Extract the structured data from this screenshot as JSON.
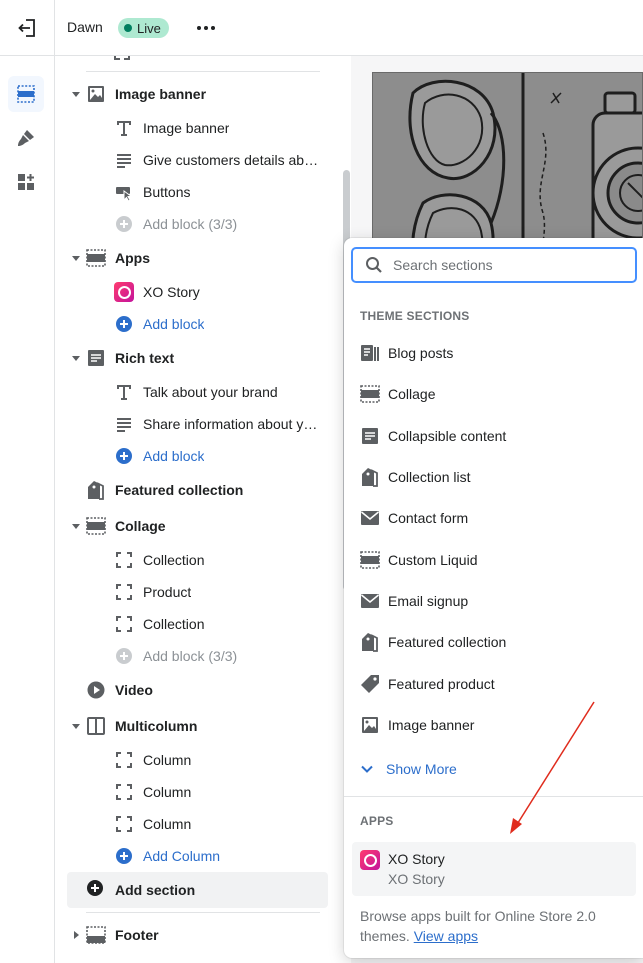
{
  "topbar": {
    "theme_name": "Dawn",
    "status_badge": "Live"
  },
  "tree": {
    "sections": [
      {
        "label": "Image banner",
        "expanded": true,
        "icon": "image-icon",
        "blocks": [
          {
            "label": "Image banner",
            "icon": "text-icon"
          },
          {
            "label": "Give customers details ab…",
            "icon": "paragraph-icon"
          },
          {
            "label": "Buttons",
            "icon": "button-icon"
          },
          {
            "label": "Add block (3/3)",
            "icon": "add-circle-icon",
            "muted": true
          }
        ]
      },
      {
        "label": "Apps",
        "expanded": true,
        "icon": "apps-section-icon",
        "blocks": [
          {
            "label": "XO Story",
            "icon": "xo-story-app-icon"
          },
          {
            "label": "Add block",
            "icon": "add-circle-icon",
            "add": true
          }
        ]
      },
      {
        "label": "Rich text",
        "expanded": true,
        "icon": "rich-text-icon",
        "blocks": [
          {
            "label": "Talk about your brand",
            "icon": "text-icon"
          },
          {
            "label": "Share information about y…",
            "icon": "paragraph-icon"
          },
          {
            "label": "Add block",
            "icon": "add-circle-icon",
            "add": true
          }
        ]
      },
      {
        "label": "Featured collection",
        "expanded": false,
        "icon": "collection-tags-icon",
        "blocks": []
      },
      {
        "label": "Collage",
        "expanded": true,
        "icon": "collage-icon",
        "blocks": [
          {
            "label": "Collection",
            "icon": "frame-icon"
          },
          {
            "label": "Product",
            "icon": "frame-icon"
          },
          {
            "label": "Collection",
            "icon": "frame-icon"
          },
          {
            "label": "Add block (3/3)",
            "icon": "add-circle-icon",
            "muted": true
          }
        ]
      },
      {
        "label": "Video",
        "expanded": false,
        "icon": "play-icon",
        "blocks": []
      },
      {
        "label": "Multicolumn",
        "expanded": true,
        "icon": "columns-icon",
        "blocks": [
          {
            "label": "Column",
            "icon": "frame-icon"
          },
          {
            "label": "Column",
            "icon": "frame-icon"
          },
          {
            "label": "Column",
            "icon": "frame-icon"
          },
          {
            "label": "Add Column",
            "icon": "add-circle-icon",
            "add": true
          }
        ]
      }
    ],
    "add_section_label": "Add section",
    "footer_label": "Footer"
  },
  "picker": {
    "search_placeholder": "Search sections",
    "theme_sections_header": "THEME SECTIONS",
    "theme_sections": [
      {
        "label": "Blog posts",
        "icon": "blog-icon"
      },
      {
        "label": "Collage",
        "icon": "collage-icon"
      },
      {
        "label": "Collapsible content",
        "icon": "rich-text-icon"
      },
      {
        "label": "Collection list",
        "icon": "collection-tags-icon"
      },
      {
        "label": "Contact form",
        "icon": "envelope-icon"
      },
      {
        "label": "Custom Liquid",
        "icon": "collage-icon"
      },
      {
        "label": "Email signup",
        "icon": "envelope-icon"
      },
      {
        "label": "Featured collection",
        "icon": "collection-tags-icon"
      },
      {
        "label": "Featured product",
        "icon": "tag-icon"
      },
      {
        "label": "Image banner",
        "icon": "image-icon"
      }
    ],
    "show_more_label": "Show More",
    "apps_header": "APPS",
    "app_item": {
      "title": "XO Story",
      "subtitle": "XO Story"
    },
    "apps_footer_text": "Browse apps built for Online Store 2.0 themes.",
    "apps_footer_link": "View apps"
  },
  "colors": {
    "accent_blue": "#2c6ecb",
    "focus_blue": "#458fff",
    "live_green": "#aee9d1",
    "annotation_arrow": "#e02c1d"
  }
}
